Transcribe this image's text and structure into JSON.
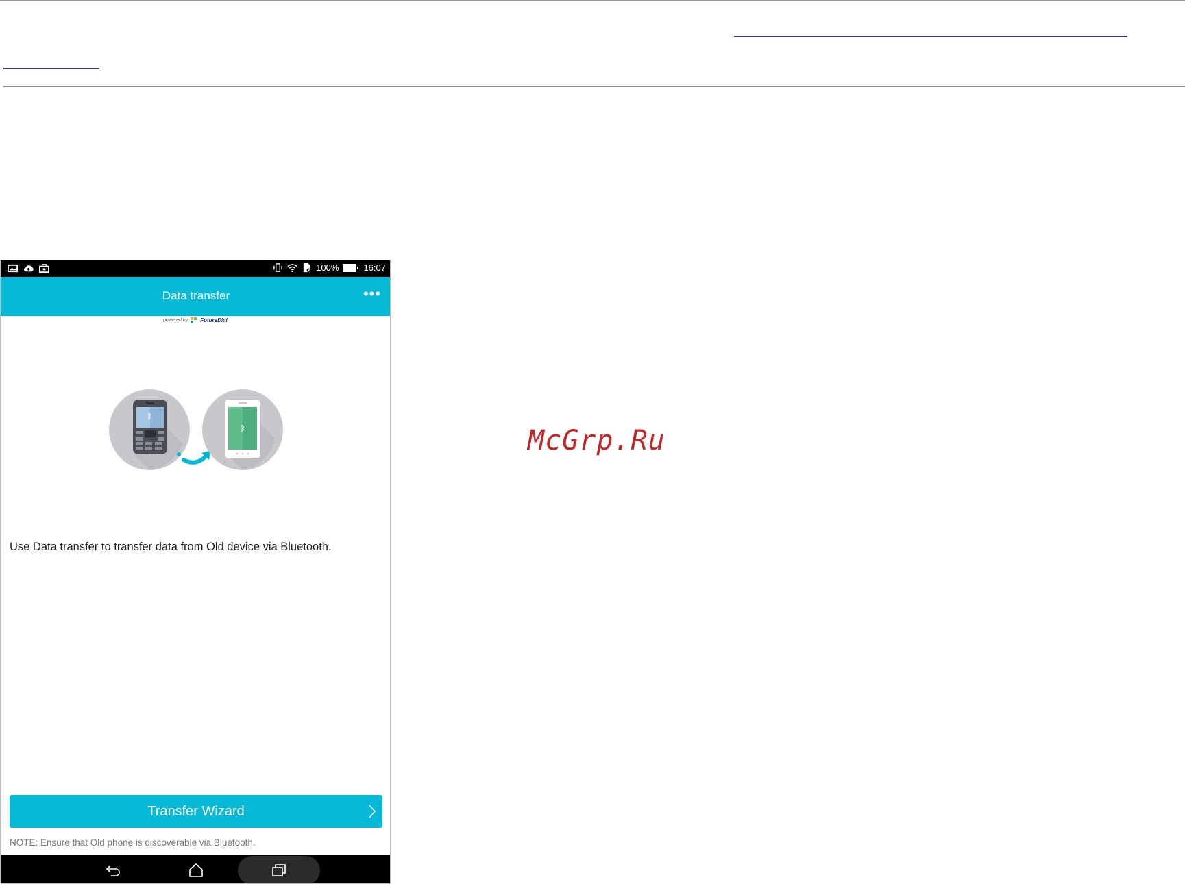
{
  "page": {
    "watermark": "McGrp.Ru"
  },
  "status_bar": {
    "left_icons": [
      "gallery-icon",
      "cloud-upload-icon",
      "briefcase-icon"
    ],
    "right_icons": [
      "vibrate-icon",
      "wifi-icon",
      "sim-icon",
      "battery-icon"
    ],
    "battery_text": "100%",
    "time": "16:07"
  },
  "app_bar": {
    "title": "Data transfer",
    "menu_icon": "more-horizontal-icon"
  },
  "branding": {
    "powered_by": "powered by",
    "logo_text": "FutureDial"
  },
  "illustration": {
    "from_device_icon": "feature-phone-icon",
    "to_device_icon": "smartphone-icon",
    "arrow_icon": "transfer-arrow-icon",
    "colors": {
      "circle": "#c8c8cc",
      "accent": "#06b9d6",
      "screen_old": "#8fb6d9",
      "screen_new": "#4caf7d"
    }
  },
  "main": {
    "description": "Use Data transfer to transfer data from Old device via Bluetooth."
  },
  "actions": {
    "wizard_label": "Transfer Wizard",
    "note": "NOTE: Ensure that Old phone is discoverable via Bluetooth."
  },
  "nav_bar": {
    "icons": [
      "back-icon",
      "home-icon",
      "recent-apps-icon"
    ]
  },
  "colors": {
    "accent": "#06b9d6",
    "link": "#2b3a8c",
    "watermark": "#c0282a"
  }
}
